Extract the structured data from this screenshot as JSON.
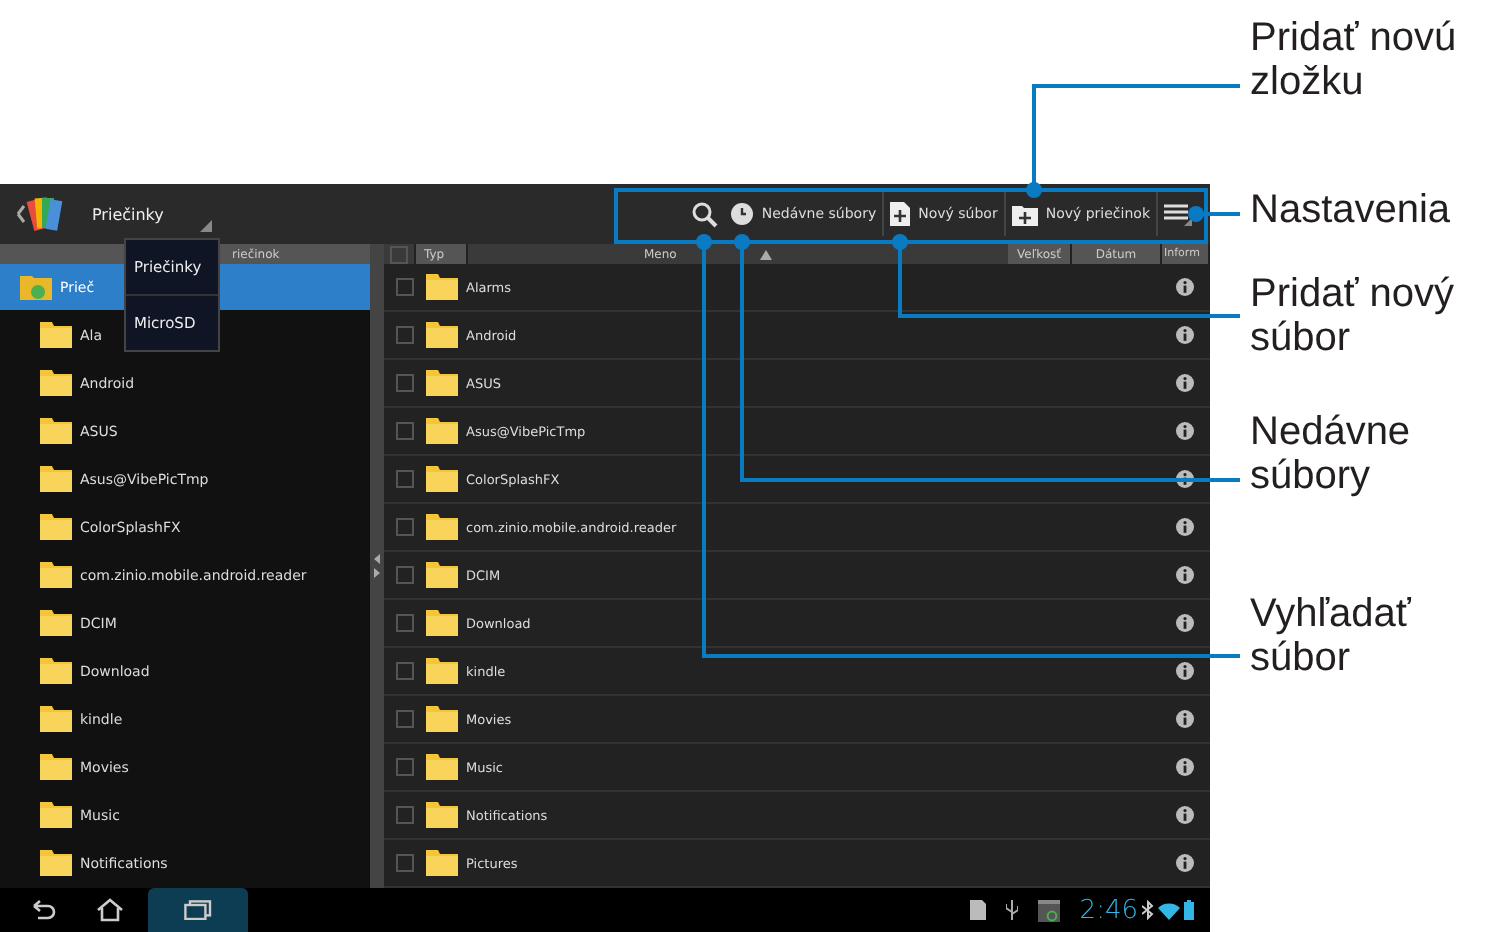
{
  "top_bar": {
    "title": "Priečinky",
    "toolbar": [
      {
        "kind": "search"
      },
      {
        "kind": "recent",
        "label": "Nedávne súbory"
      },
      {
        "kind": "new_file",
        "label": "Nový súbor"
      },
      {
        "kind": "new_folder",
        "label": "Nový priečinok"
      },
      {
        "kind": "menu"
      }
    ]
  },
  "dropdown": [
    {
      "label": "Priečinky"
    },
    {
      "label": "MicroSD"
    }
  ],
  "folder_tree": {
    "header": "riečinok",
    "root": {
      "label": "Prieč",
      "selected": true,
      "children": [
        {
          "label": "Ala",
          "selected": false
        },
        {
          "label": "Android",
          "selected": false
        },
        {
          "label": "ASUS",
          "selected": false
        },
        {
          "label": "Asus@VibePicTmp",
          "selected": false
        },
        {
          "label": "ColorSplashFX",
          "selected": false
        },
        {
          "label": "com.zinio.mobile.android.reader",
          "selected": false
        },
        {
          "label": "DCIM",
          "selected": false
        },
        {
          "label": "Download",
          "selected": false
        },
        {
          "label": "kindle",
          "selected": false
        },
        {
          "label": "Movies",
          "selected": false
        },
        {
          "label": "Music",
          "selected": false
        },
        {
          "label": "Notifications",
          "selected": false
        }
      ]
    }
  },
  "file_list": {
    "select_all": {
      "checked": false
    },
    "columns": [
      "Typ",
      "Meno",
      "Veľkosť",
      "Dátum",
      "Inform"
    ],
    "rows": [
      {
        "name": "Alarms",
        "checked": false
      },
      {
        "name": "Android",
        "checked": false
      },
      {
        "name": "ASUS",
        "checked": false
      },
      {
        "name": "Asus@VibePicTmp",
        "checked": false
      },
      {
        "name": "ColorSplashFX",
        "checked": false
      },
      {
        "name": "com.zinio.mobile.android.reader",
        "checked": false
      },
      {
        "name": "DCIM",
        "checked": false
      },
      {
        "name": "Download",
        "checked": false
      },
      {
        "name": "kindle",
        "checked": false
      },
      {
        "name": "Movies",
        "checked": false
      },
      {
        "name": "Music",
        "checked": false
      },
      {
        "name": "Notifications",
        "checked": false
      },
      {
        "name": "Pictures",
        "checked": false
      }
    ]
  },
  "status_bar": {
    "time": "2:46"
  },
  "callouts": [
    {
      "label": "Pridať novú zložku"
    },
    {
      "label": "Nastavenia"
    },
    {
      "label": "Pridať nový súbor"
    },
    {
      "label": "Nedávne súbory"
    },
    {
      "label": "Vyhľadať súbor"
    }
  ]
}
